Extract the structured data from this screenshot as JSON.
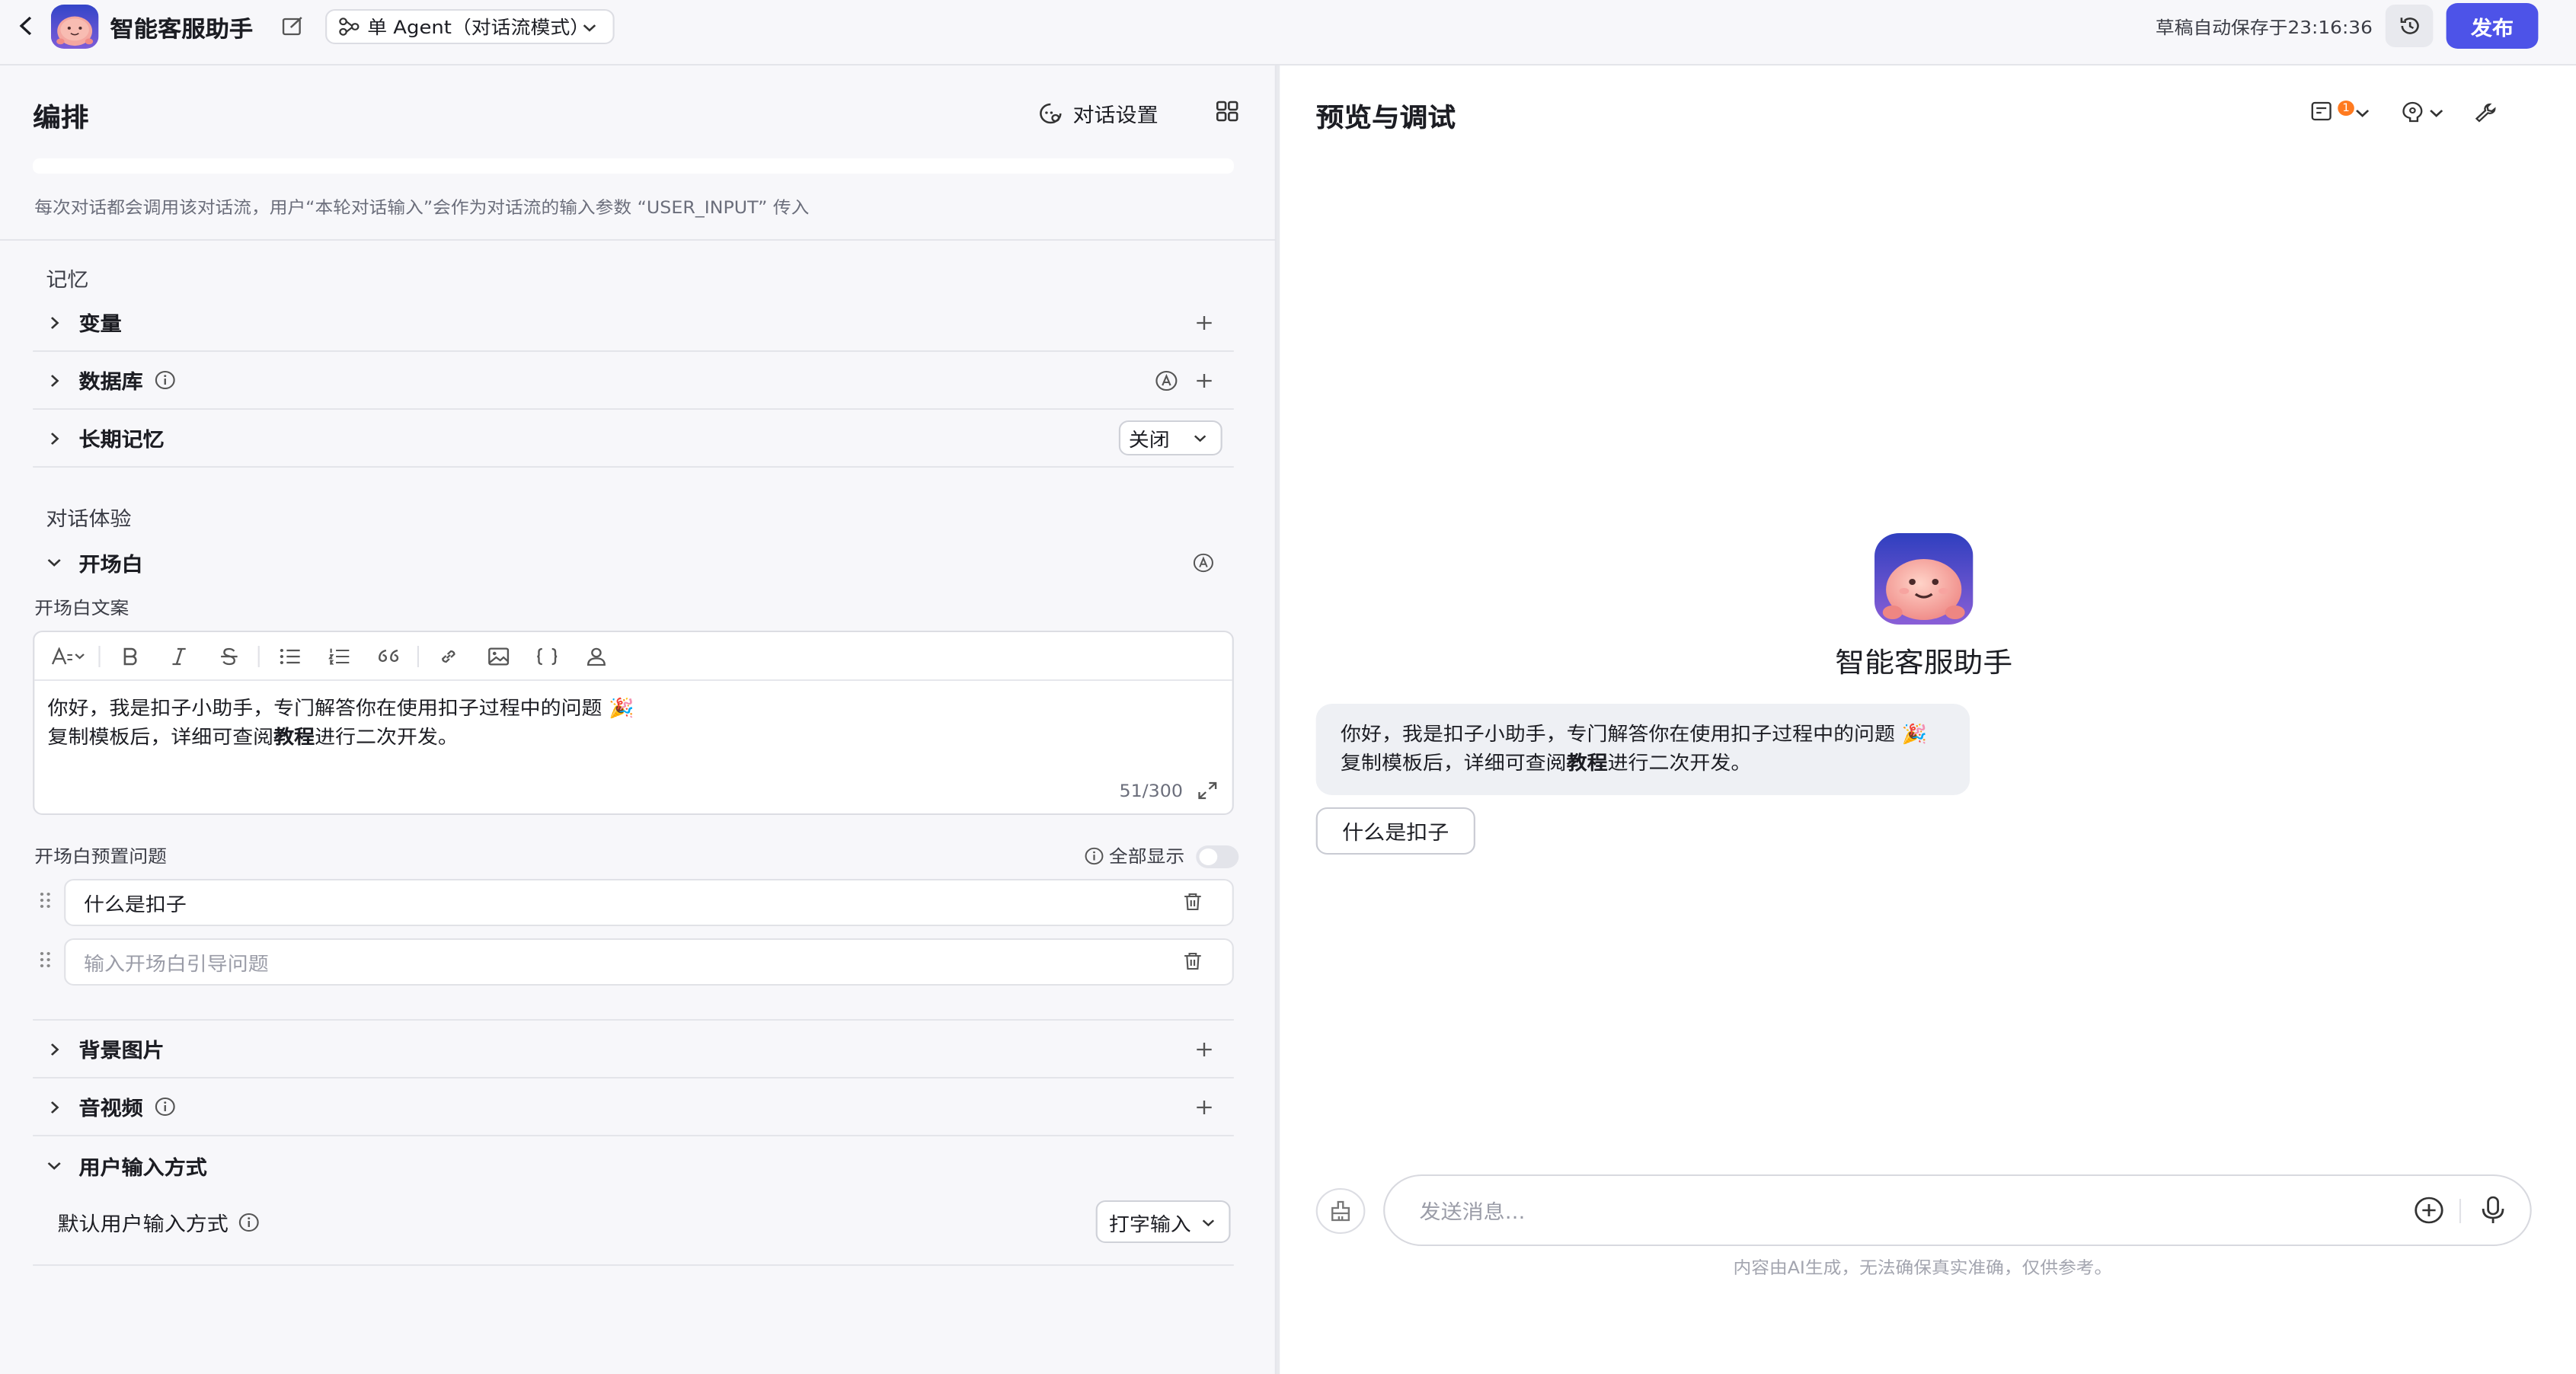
{
  "header": {
    "app_title": "智能客服助手",
    "mode_label": "单 Agent（对话流模式）",
    "saved_text": "草稿自动保存于23:16:36",
    "publish_label": "发布"
  },
  "left": {
    "title": "编排",
    "chat_settings_label": "对话设置",
    "hint": "每次对话都会调用该对话流，用户“本轮对话输入”会作为对话流的输入参数 “USER_INPUT” 传入",
    "memory_label": "记忆",
    "rows": {
      "variables": "变量",
      "database": "数据库",
      "long_memory": "长期记忆",
      "long_memory_value": "关闭"
    },
    "experience_label": "对话体验",
    "opening": {
      "title": "开场白",
      "text_label": "开场白文案",
      "line1": "你好，我是扣子小助手，专门解答你在使用扣子过程中的问题 🎉",
      "line2_pre": "复制模板后，详细可查阅",
      "line2_bold": "教程",
      "line2_post": "进行二次开发。",
      "counter": "51/300",
      "preset_label": "开场白预置问题",
      "show_all_label": "全部显示",
      "q1": "什么是扣子",
      "q2_placeholder": "输入开场白引导问题"
    },
    "background": "背景图片",
    "av": "音视频",
    "input_method": "用户输入方式",
    "default_input_label": "默认用户输入方式",
    "default_input_value": "打字输入"
  },
  "right": {
    "title": "预览与调试",
    "badge": "1",
    "bot_name": "智能客服助手",
    "bubble_line1": "你好，我是扣子小助手，专门解答你在使用扣子过程中的问题 🎉",
    "bubble_line2_pre": "复制模板后，详细可查阅",
    "bubble_line2_bold": "教程",
    "bubble_line2_post": "进行二次开发。",
    "suggestion": "什么是扣子",
    "composer_placeholder": "发送消息...",
    "disclaimer": "内容由AI生成，无法确保真实准确，仅供参考。"
  },
  "colors": {
    "accent": "#4d53e8",
    "badge": "#ff7a1f",
    "panel_bg": "#f7f7fa"
  }
}
